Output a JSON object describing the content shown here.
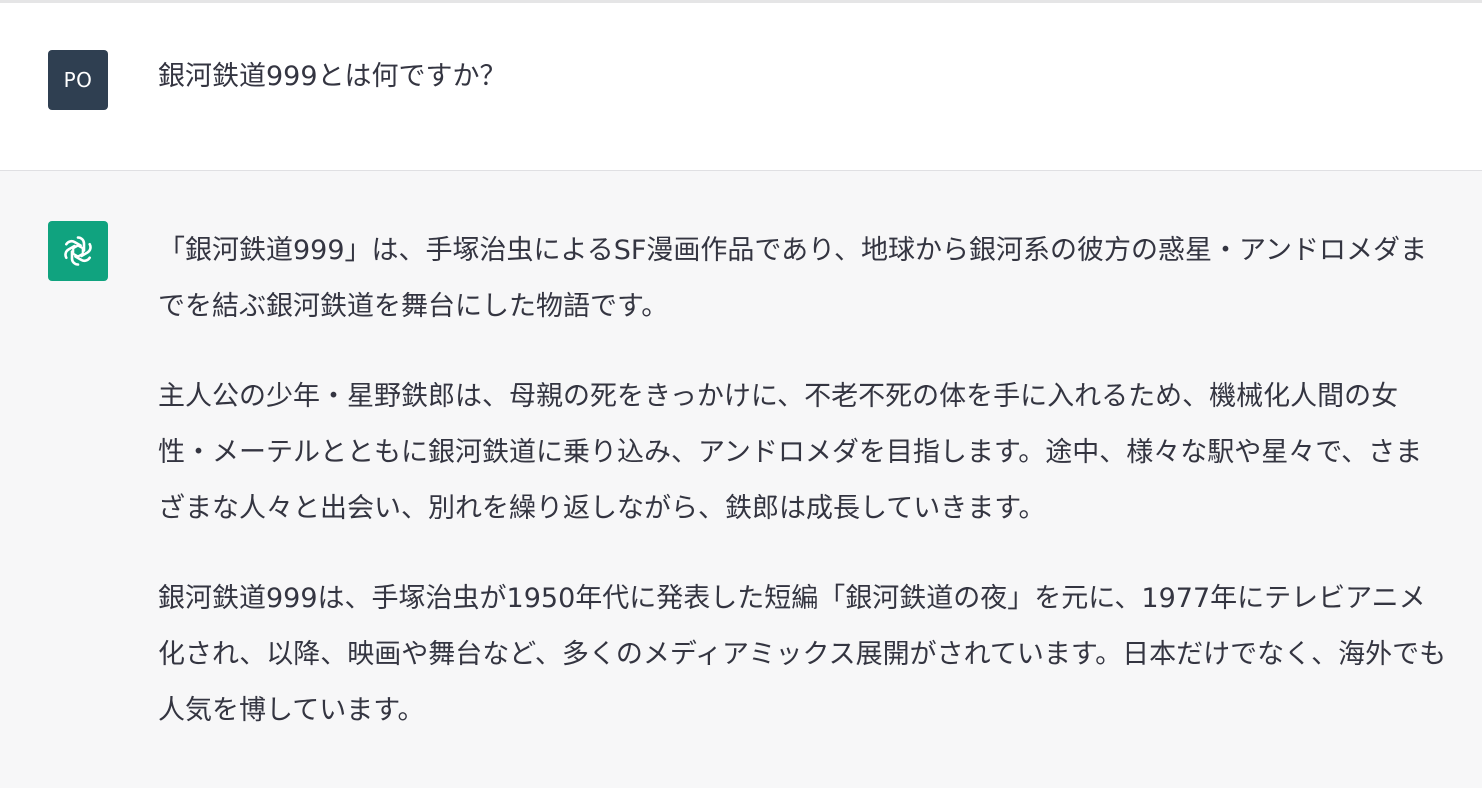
{
  "user": {
    "avatar_initials": "PO",
    "message": "銀河鉄道999とは何ですか？"
  },
  "assistant": {
    "avatar_icon": "openai-logo-icon",
    "paragraphs": [
      "「銀河鉄道999」は、手塚治虫によるSF漫画作品であり、地球から銀河系の彼方の惑星・アンドロメダまでを結ぶ銀河鉄道を舞台にした物語です。",
      "主人公の少年・星野鉄郎は、母親の死をきっかけに、不老不死の体を手に入れるため、機械化人間の女性・メーテルとともに銀河鉄道に乗り込み、アンドロメダを目指します。途中、様々な駅や星々で、さまざまな人々と出会い、別れを繰り返しながら、鉄郎は成長していきます。",
      "銀河鉄道999は、手塚治虫が1950年代に発表した短編「銀河鉄道の夜」を元に、1977年にテレビアニメ化され、以降、映画や舞台など、多くのメディアミックス展開がされています。日本だけでなく、海外でも人気を博しています。"
    ]
  },
  "colors": {
    "user_avatar": "#2f3f51",
    "assistant_avatar": "#10a37f",
    "assistant_background": "#f7f7f8",
    "text": "#343541"
  }
}
